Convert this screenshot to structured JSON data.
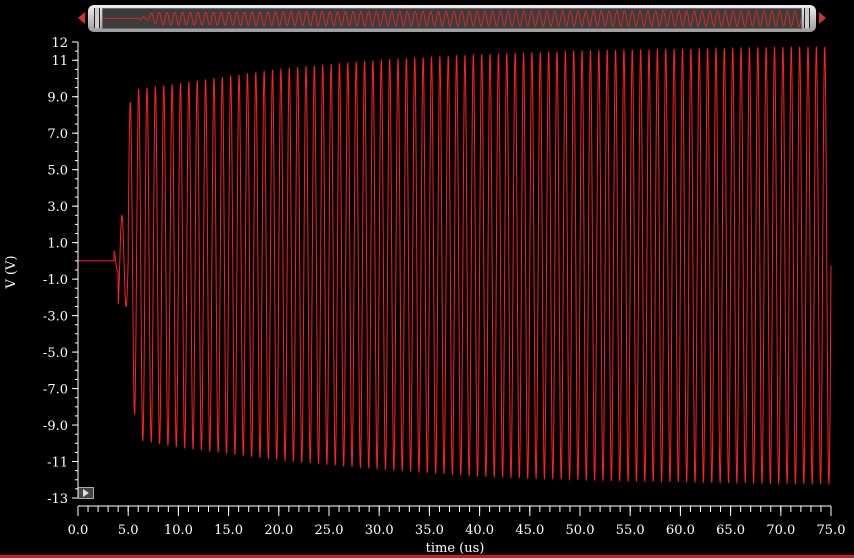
{
  "chart_data": {
    "type": "line",
    "xlabel": "time (us)",
    "ylabel": "V (V)",
    "xlim": [
      0,
      75
    ],
    "ylim": [
      -13,
      12
    ],
    "x_ticks": [
      "0.0",
      "5.0",
      "10.0",
      "15.0",
      "20.0",
      "25.0",
      "30.0",
      "35.0",
      "40.0",
      "45.0",
      "50.0",
      "55.0",
      "60.0",
      "65.0",
      "70.0",
      "75.0"
    ],
    "y_ticks": [
      "12",
      "11",
      "9.0",
      "7.0",
      "5.0",
      "3.0",
      "1.0",
      "-1.0",
      "-3.0",
      "-5.0",
      "-7.0",
      "-9.0",
      "-11",
      "-13"
    ],
    "y_tick_values": [
      12,
      11,
      9,
      7,
      5,
      3,
      1,
      -1,
      -3,
      -5,
      -7,
      -9,
      -11,
      -13
    ],
    "grid": false,
    "colors": {
      "series": "#ff2020",
      "axis": "#ffffff",
      "background": "#000000"
    },
    "series": [
      {
        "frequency_mhz": 1.2,
        "segments": [
          {
            "t_start": 0.0,
            "t_end": 3.6,
            "amplitude": 0.0
          },
          {
            "t_start": 3.6,
            "t_end": 4.0,
            "amplitude": 0.6
          },
          {
            "t_start": 4.0,
            "t_end": 5.0,
            "amplitude": 2.5
          }
        ],
        "envelope": {
          "x": [
            5.0,
            6.0,
            10.0,
            20.0,
            30.0,
            40.0,
            50.0,
            60.0,
            70.0,
            75.0
          ],
          "upper": [
            8.5,
            9.4,
            9.7,
            10.5,
            11.0,
            11.3,
            11.5,
            11.6,
            11.7,
            11.7
          ],
          "lower": [
            -6.0,
            -9.8,
            -10.2,
            -10.9,
            -11.4,
            -11.8,
            -12.0,
            -12.1,
            -12.2,
            -12.2
          ]
        }
      }
    ]
  },
  "controls": {
    "overview_slider": "overview-slider",
    "play_icon": "play-icon"
  }
}
